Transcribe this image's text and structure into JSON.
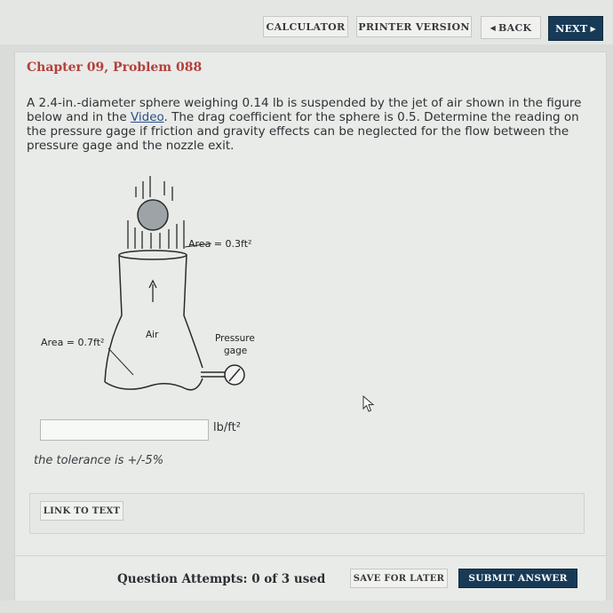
{
  "toolbar": {
    "calculator": "CALCULATOR",
    "printer": "PRINTER VERSION",
    "back": "BACK",
    "next": "NEXT"
  },
  "problem": {
    "title": "Chapter 09, Problem 088",
    "text_before_link": "A 2.4-in.-diameter sphere weighing 0.14 lb is suspended by the jet of air shown in the figure below and in the ",
    "link_text": "Video",
    "text_after_link": ". The drag coefficient for the sphere is 0.5. Determine the reading on the pressure gage if friction and gravity effects can be neglected for the flow between the pressure gage and the nozzle exit."
  },
  "figure": {
    "exit_area_label": "Area = 0.3ft²",
    "inlet_area_label": "Area = 0.7ft²",
    "air_label": "Air",
    "gage_label_line1": "Pressure",
    "gage_label_line2": "gage"
  },
  "answer": {
    "value": "",
    "unit": "lb/ft²",
    "tolerance": "the tolerance is +/-5%"
  },
  "link_to_text": "LINK TO TEXT",
  "footer": {
    "attempts": "Question Attempts: 0 of 3 used",
    "save": "SAVE FOR LATER",
    "submit": "SUBMIT ANSWER"
  },
  "colors": {
    "title_red": "#b3403a",
    "next_button": "#173a57",
    "submit_button": "#173a57",
    "link_blue": "#2b4f8a"
  },
  "icons": {
    "back_arrow": "triangle-left-icon",
    "next_arrow": "triangle-right-icon",
    "mouse_cursor": "pointer-arrow-icon"
  }
}
